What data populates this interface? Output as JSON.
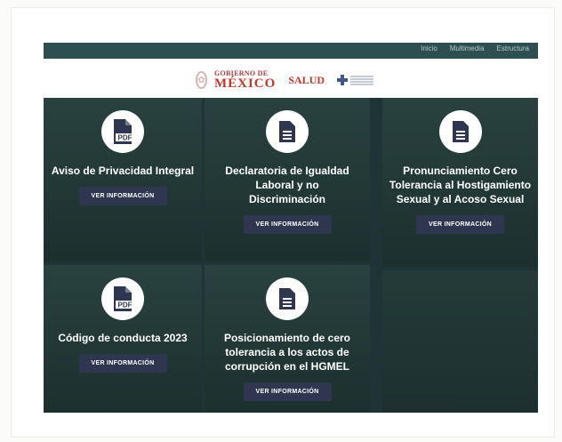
{
  "nav": {
    "items": [
      "Inicio",
      "Multimedia",
      "Estructura"
    ]
  },
  "logos": {
    "gobierno_top": "GOBIERNO DE",
    "gobierno_main": "MÉXICO",
    "salud": "SALUD"
  },
  "cards": [
    {
      "title": "Aviso de Privacidad Integral",
      "icon": "pdf-icon",
      "button": "VER INFORMACIÓN"
    },
    {
      "title": "Declaratoria de Igualdad Laboral y no Discriminación",
      "icon": "document-icon",
      "button": "VER INFORMACIÓN"
    },
    {
      "title": "Pronunciamiento Cero Tolerancia al Hostigamiento Sexual y al Acoso Sexual",
      "icon": "document-icon",
      "button": "VER INFORMACIÓN"
    },
    {
      "title": "Código de conducta 2023",
      "icon": "pdf-icon",
      "button": "VER INFORMACIÓN"
    },
    {
      "title": "Posicionamiento de cero tolerancia a los actos de corrupción en el HGMEL",
      "icon": "document-icon",
      "button": "VER INFORMACIÓN"
    }
  ],
  "colors": {
    "topbar": "#2d4f52",
    "card_bg": "#223835",
    "button_bg": "#2e3650",
    "brand_red": "#c0392b"
  }
}
